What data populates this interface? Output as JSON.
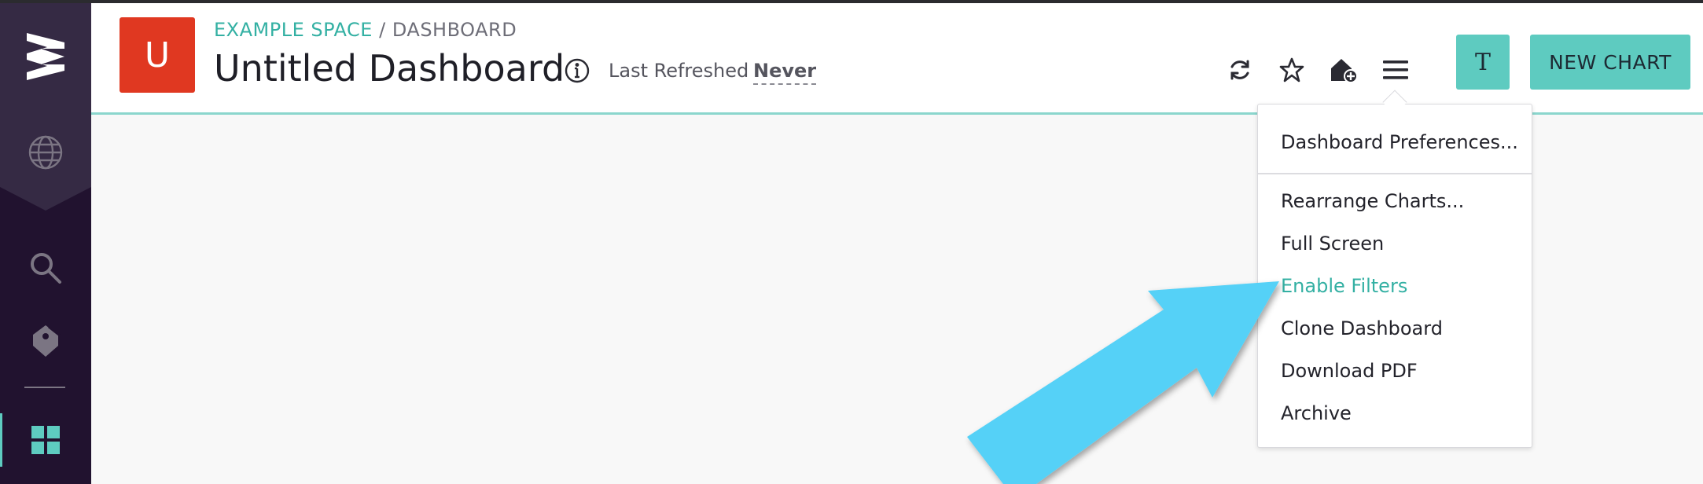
{
  "sidebar": {
    "logo_icon": "app-logo-icon",
    "items": [
      {
        "icon": "globe-icon"
      },
      {
        "icon": "search-icon"
      },
      {
        "icon": "tag-icon"
      },
      {
        "icon": "dashboard-grid-icon",
        "active": true
      }
    ],
    "colors": {
      "background": "#21122f",
      "top": "#352a44",
      "active": "#5ecbc0"
    }
  },
  "header": {
    "avatar_letter": "U",
    "breadcrumb": {
      "space": "EXAMPLE SPACE",
      "separator": "/",
      "page": "DASHBOARD"
    },
    "title": "Untitled Dashboard",
    "last_refreshed_label": "Last Refreshed",
    "last_refreshed_value": "Never",
    "tools": [
      "refresh-icon",
      "star-icon",
      "home-add-icon",
      "menu-icon"
    ],
    "user_initial": "T",
    "new_chart_label": "NEW CHART",
    "colors": {
      "accent": "#5ecbc0",
      "avatar": "#e03821",
      "breadcrumb": "#33b0a3"
    }
  },
  "menu": {
    "items": [
      {
        "label": "Dashboard Preferences..."
      },
      {
        "label": "Rearrange Charts..."
      },
      {
        "label": "Full Screen"
      },
      {
        "label": "Enable Filters",
        "highlighted": true
      },
      {
        "label": "Clone Dashboard"
      },
      {
        "label": "Download PDF"
      },
      {
        "label": "Archive"
      }
    ]
  },
  "annotation": {
    "icon": "arrow-pointer-icon",
    "color": "#55d1f7"
  }
}
